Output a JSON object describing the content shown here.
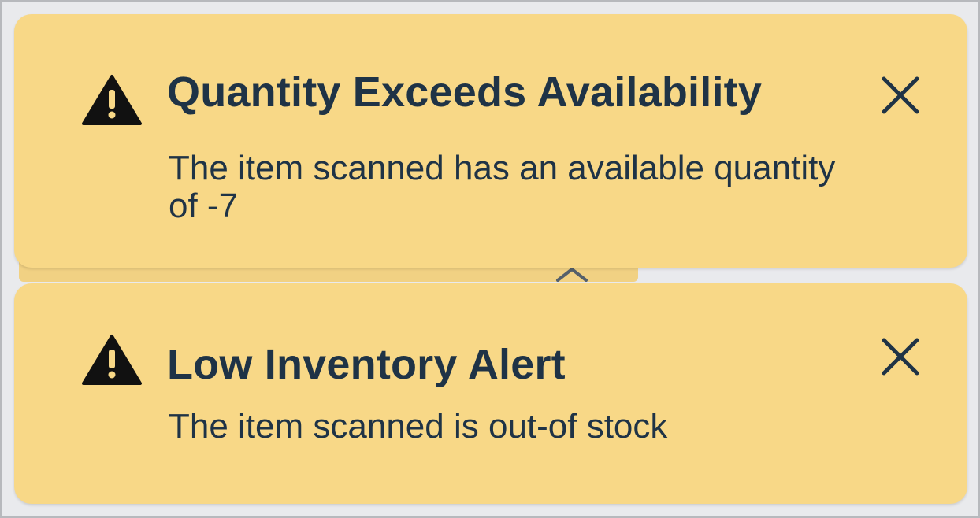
{
  "alerts": [
    {
      "title": "Quantity Exceeds Availability",
      "message": "The item scanned has an available quantity of -7",
      "icon": "warning-icon",
      "close_icon": "close-icon"
    },
    {
      "title": "Low Inventory Alert",
      "message": "The item scanned is out-of stock",
      "icon": "warning-icon",
      "close_icon": "close-icon"
    }
  ],
  "colors": {
    "toast_background": "#f8d887",
    "text": "#1f3346",
    "icon": "#111111",
    "page_background": "#e9eaed"
  }
}
